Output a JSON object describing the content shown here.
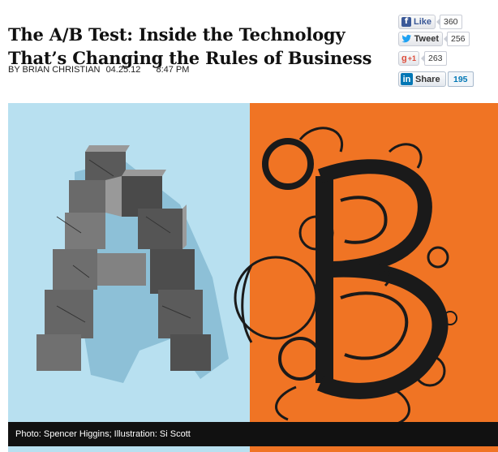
{
  "article": {
    "headline": "The A/B Test: Inside the Technology That’s Changing the Rules of Business",
    "byline": "BY BRIAN CHRISTIAN",
    "date": "04.25.12",
    "time": "8:47 PM"
  },
  "share": {
    "facebook": {
      "label": "Like",
      "count": "360",
      "icon": "facebook-icon",
      "color": "#3b5998"
    },
    "twitter": {
      "label": "Tweet",
      "count": "256",
      "icon": "twitter-bird-icon",
      "color": "#1da1f2"
    },
    "googleplus": {
      "label": "+1",
      "count": "263",
      "icon": "google-plus-icon",
      "color": "#dd4b39"
    },
    "linkedin": {
      "label": "Share",
      "count": "195",
      "icon": "linkedin-icon",
      "color": "#0077b5"
    }
  },
  "hero": {
    "left_color": "#b8e0f0",
    "right_color": "#f07424",
    "caption": "Photo: Spencer Higgins; Illustration: Si Scott"
  }
}
